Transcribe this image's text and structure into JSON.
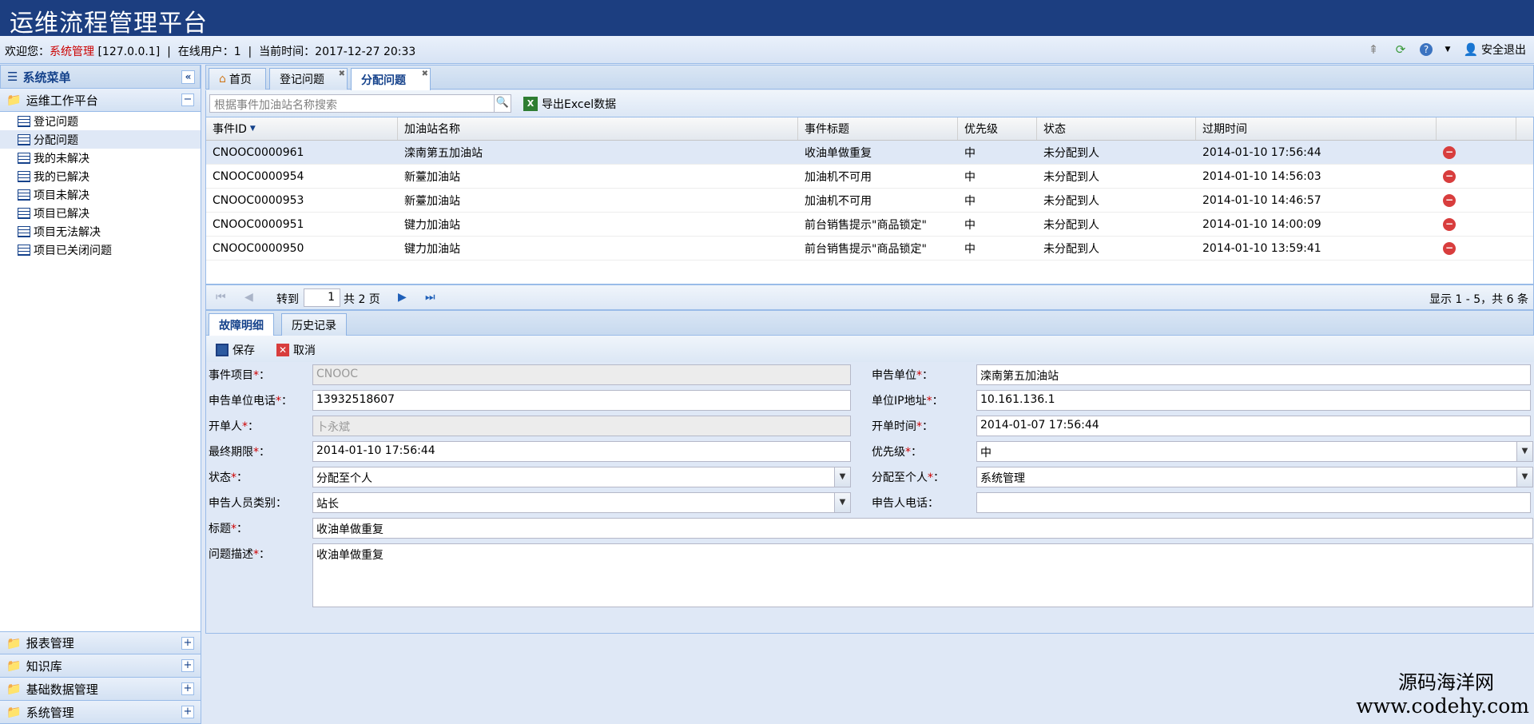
{
  "app": {
    "title": "运维流程管理平台"
  },
  "status_bar": {
    "welcome_label": "欢迎您：",
    "user_name": "系统管理",
    "ip": "[127.0.0.1]",
    "online_users": "在线用户：1",
    "current_time": "当前时间：2017-12-27 20:33",
    "logout_label": "安全退出"
  },
  "sidebar": {
    "title": "系统菜单",
    "sections": [
      {
        "label": "运维工作平台",
        "expanded": true
      },
      {
        "label": "报表管理"
      },
      {
        "label": "知识库"
      },
      {
        "label": "基础数据管理"
      },
      {
        "label": "系统管理"
      }
    ],
    "items": [
      {
        "label": "登记问题"
      },
      {
        "label": "分配问题"
      },
      {
        "label": "我的未解决"
      },
      {
        "label": "我的已解决"
      },
      {
        "label": "项目未解决"
      },
      {
        "label": "项目已解决"
      },
      {
        "label": "项目无法解决"
      },
      {
        "label": "项目已关闭问题"
      }
    ]
  },
  "tabs": [
    {
      "label": "首页"
    },
    {
      "label": "登记问题"
    },
    {
      "label": "分配问题",
      "active": true
    }
  ],
  "toolbar": {
    "search_placeholder": "根据事件加油站名称搜索",
    "export_label": "导出Excel数据"
  },
  "grid": {
    "headers": [
      "事件ID",
      "加油站名称",
      "事件标题",
      "优先级",
      "状态",
      "过期时间"
    ],
    "rows": [
      [
        "CNOOC0000961",
        "滦南第五加油站",
        "收油单做重复",
        "中",
        "未分配到人",
        "2014-01-10 17:56:44"
      ],
      [
        "CNOOC0000954",
        "新薹加油站",
        "加油机不可用",
        "中",
        "未分配到人",
        "2014-01-10 14:56:03"
      ],
      [
        "CNOOC0000953",
        "新薹加油站",
        "加油机不可用",
        "中",
        "未分配到人",
        "2014-01-10 14:46:57"
      ],
      [
        "CNOOC0000951",
        "键力加油站",
        "前台销售提示\"商品锁定\"",
        "中",
        "未分配到人",
        "2014-01-10 14:00:09"
      ],
      [
        "CNOOC0000950",
        "键力加油站",
        "前台销售提示\"商品锁定\"",
        "中",
        "未分配到人",
        "2014-01-10 13:59:41"
      ]
    ]
  },
  "pager": {
    "goto_label": "转到",
    "page": "1",
    "total": "共 2 页",
    "info": "显示 1 - 5，共 6 条"
  },
  "detail_tabs": [
    {
      "label": "故障明细",
      "active": true
    },
    {
      "label": "历史记录"
    }
  ],
  "detail_toolbar": {
    "save_label": "保存",
    "cancel_label": "取消"
  },
  "form": {
    "project_label": "事件项目",
    "project_value": "CNOOC",
    "unit_label": "申告单位",
    "unit_value": "滦南第五加油站",
    "unit_phone_label": "申告单位电话",
    "unit_phone_value": "13932518607",
    "unit_ip_label": "单位IP地址",
    "unit_ip_value": "10.161.136.1",
    "opener_label": "开单人",
    "opener_value": "卜永斌",
    "open_time_label": "开单时间",
    "open_time_value": "2014-01-07 17:56:44",
    "deadline_label": "最终期限",
    "deadline_value": "2014-01-10 17:56:44",
    "priority_label": "优先级",
    "priority_value": "中",
    "status_label": "状态",
    "status_value": "分配至个人",
    "assignee_label": "分配至个人",
    "assignee_value": "系统管理",
    "reporter_type_label": "申告人员类别",
    "reporter_type_value": "站长",
    "reporter_phone_label": "申告人电话",
    "reporter_phone_value": "",
    "subject_label": "标题",
    "subject_value": "收油单做重复",
    "description_label": "问题描述",
    "description_value": "收油单做重复",
    "colon": "："
  },
  "watermark": {
    "name": "源码海洋网",
    "url": "www.codehy.com"
  }
}
